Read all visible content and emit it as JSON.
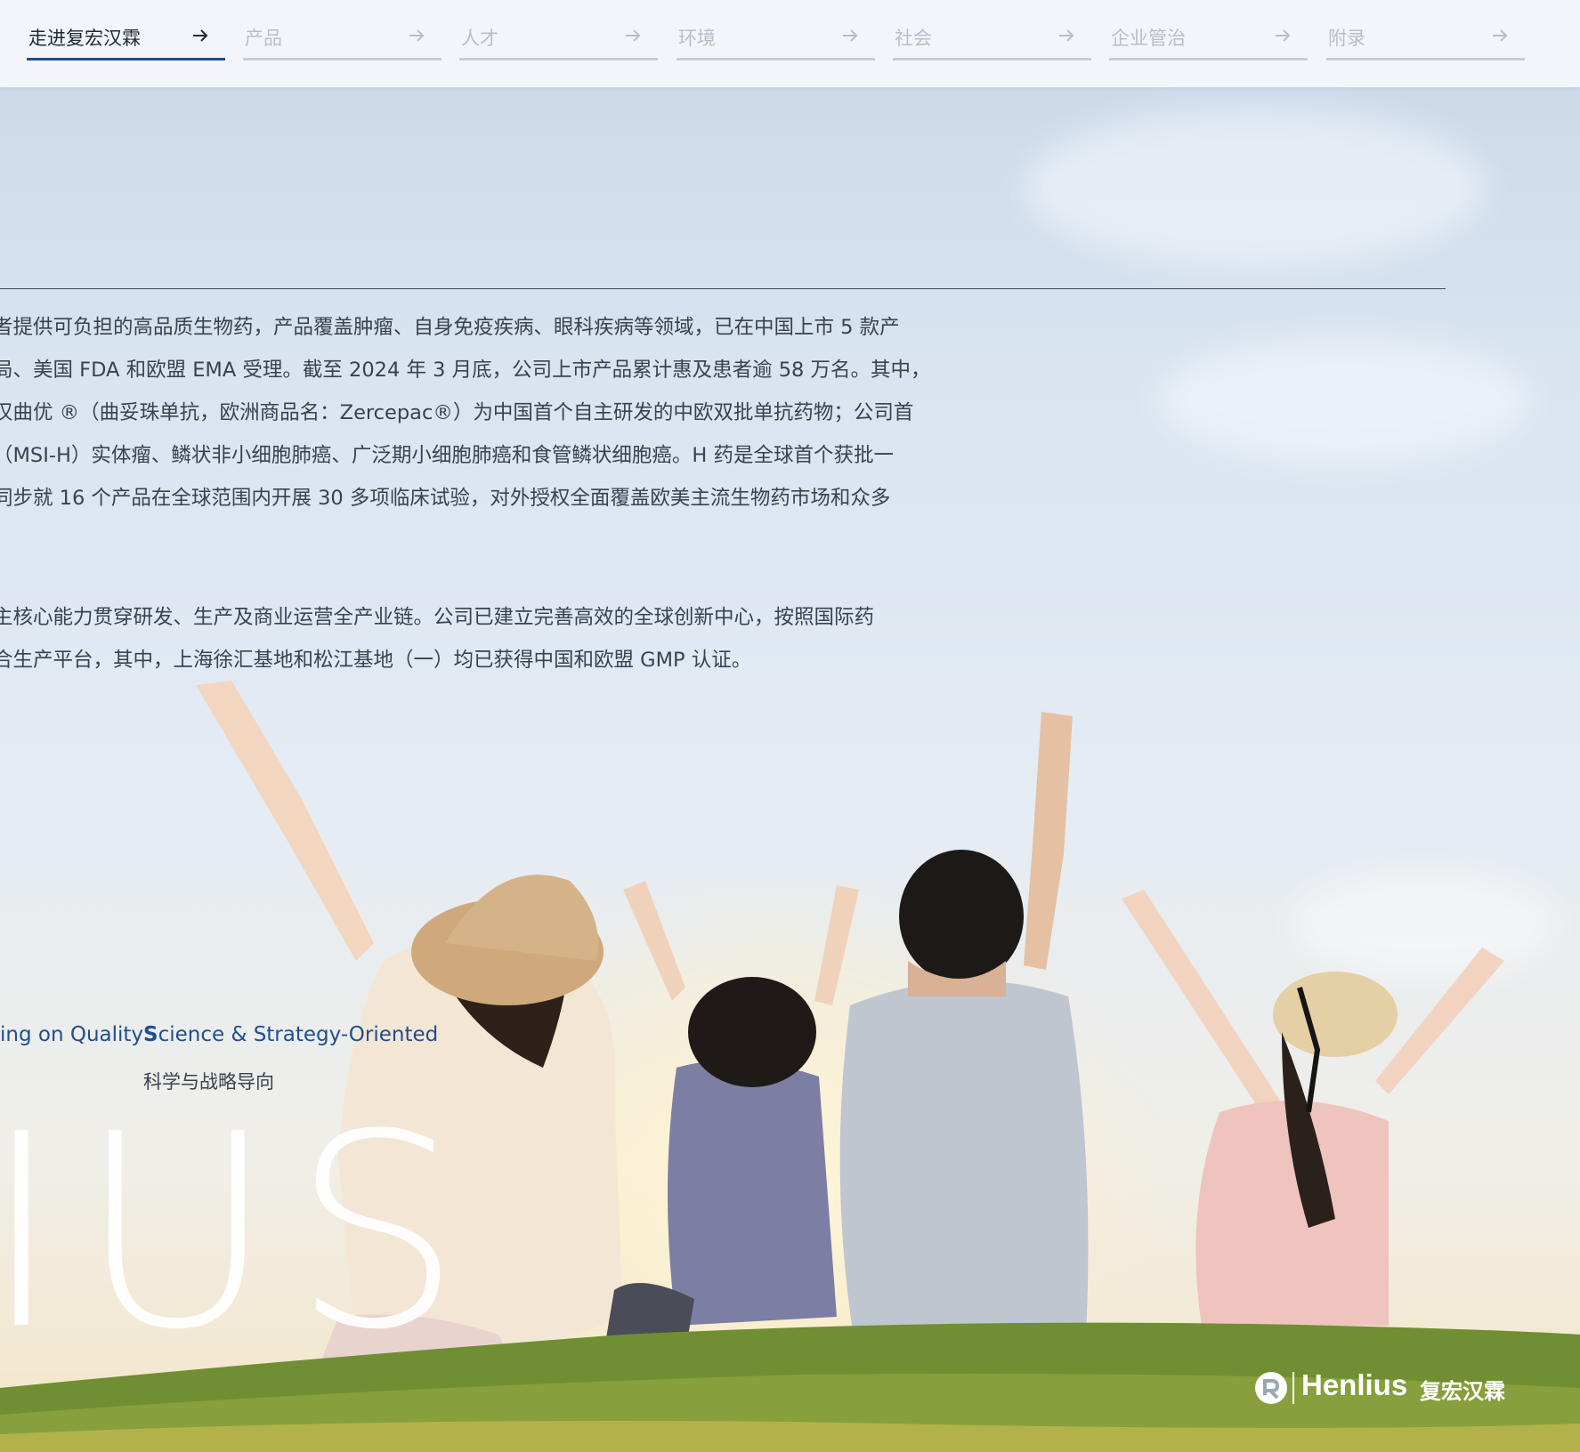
{
  "nav": {
    "items": [
      {
        "label": "走进复宏汉霖",
        "active": true
      },
      {
        "label": "产品",
        "active": false
      },
      {
        "label": "人才",
        "active": false
      },
      {
        "label": "环境",
        "active": false
      },
      {
        "label": "社会",
        "active": false
      },
      {
        "label": "企业管治",
        "active": false
      },
      {
        "label": "附录",
        "active": false
      }
    ],
    "arrow_icon": "arrow-right-icon"
  },
  "intro": {
    "paragraph1": [
      "者提供可负担的高品质生物药，产品覆盖肿瘤、自身免疫疾病、眼科疾病等领域，已在中国上市 5 款产",
      "局、美国 FDA 和欧盟 EMA 受理。截至 2024 年 3 月底，公司上市产品累计惠及患者逾 58 万名。其中，",
      "汉曲优 ®（曲妥珠单抗，欧洲商品名：Zercepac®）为中国首个自主研发的中欧双批单抗药物；公司首",
      "（MSI-H）实体瘤、鳞状非小细胞肺癌、广泛期小细胞肺癌和食管鳞状细胞癌。H 药是全球首个获批一",
      "同步就 16 个产品在全球范围内开展 30 多项临床试验，对外授权全面覆盖欧美主流生物药市场和众多"
    ],
    "paragraph2": [
      "主核心能力贯穿研发、生产及商业运营全产业链。公司已建立完善高效的全球创新中心，按照国际药",
      "合生产平台，其中，上海徐汇基地和松江基地（一）均已获得中国和欧盟 GMP 认证。"
    ]
  },
  "values": {
    "quality_en": "ing on Quality",
    "science_en_first": "S",
    "science_en_rest": "cience & Strategy-Oriented",
    "science_cn": "科学与战略导向"
  },
  "watermark": "IUS",
  "brand": {
    "name_en": "Henlius",
    "name_cn": "复宏汉霖",
    "logo_icon": "henlius-logo-icon"
  },
  "colors": {
    "accent": "#1e4f8f",
    "body_text": "#39424d",
    "nav_inactive": "#b8bec8"
  }
}
